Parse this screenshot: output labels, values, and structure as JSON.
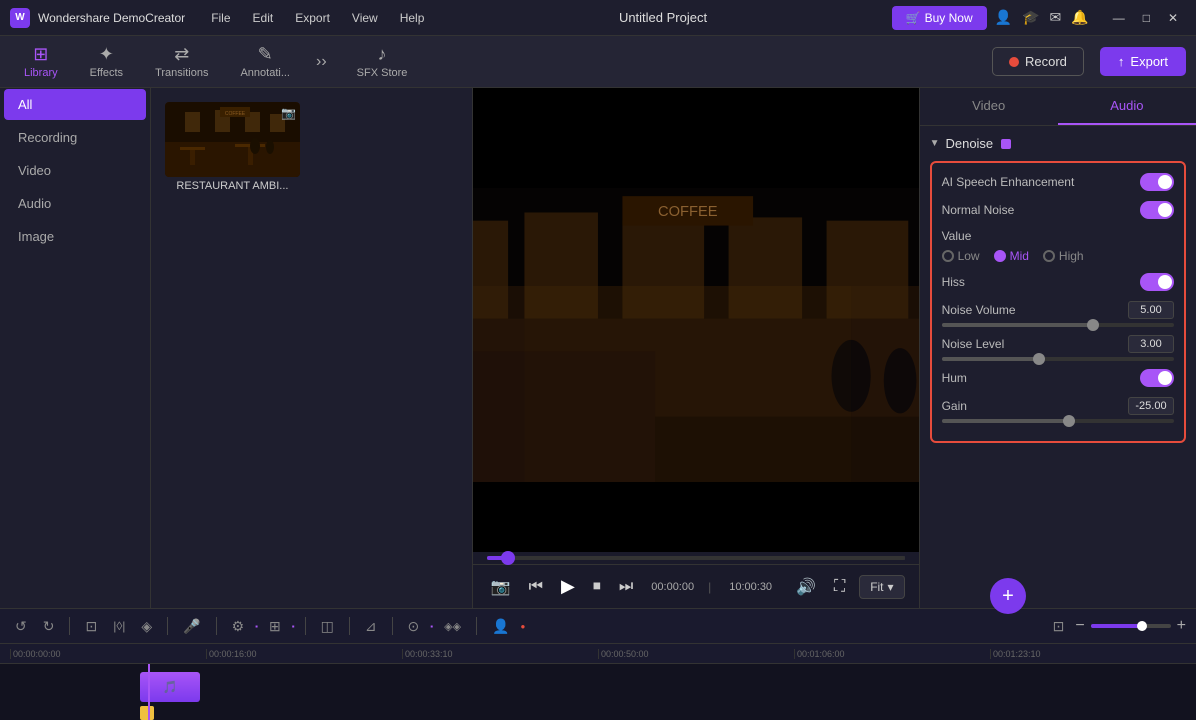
{
  "app": {
    "name": "Wondershare DemoCreator",
    "project_title": "Untitled Project"
  },
  "titlebar": {
    "menu_items": [
      "File",
      "Edit",
      "Export",
      "View",
      "Help"
    ],
    "buy_now": "Buy Now",
    "win_controls": [
      "—",
      "□",
      "✕"
    ]
  },
  "toolbar": {
    "tabs": [
      {
        "id": "library",
        "label": "Library",
        "icon": "⊞",
        "active": true
      },
      {
        "id": "effects",
        "label": "Effects",
        "icon": "✦"
      },
      {
        "id": "transitions",
        "label": "Transitions",
        "icon": "⇄"
      },
      {
        "id": "annotations",
        "label": "Annotati...",
        "icon": "✎"
      },
      {
        "id": "sfxstore",
        "label": "SFX Store",
        "icon": "♪"
      }
    ],
    "record_label": "Record",
    "export_label": "Export"
  },
  "sidebar": {
    "items": [
      {
        "id": "all",
        "label": "All",
        "active": true
      },
      {
        "id": "recording",
        "label": "Recording"
      },
      {
        "id": "video",
        "label": "Video"
      },
      {
        "id": "audio",
        "label": "Audio"
      },
      {
        "id": "image",
        "label": "Image"
      }
    ]
  },
  "media": {
    "items": [
      {
        "label": "RESTAURANT AMBI..."
      }
    ]
  },
  "preview": {
    "time_current": "00:00:00",
    "time_total": "10:00:30",
    "fit_label": "Fit"
  },
  "right_panel": {
    "tabs": [
      {
        "id": "video",
        "label": "Video"
      },
      {
        "id": "audio",
        "label": "Audio",
        "active": true
      }
    ],
    "section": {
      "title": "Denoise",
      "controls": {
        "ai_speech_label": "AI Speech Enhancement",
        "normal_noise_label": "Normal Noise",
        "value_label": "Value",
        "value_options": [
          {
            "id": "low",
            "label": "Low"
          },
          {
            "id": "mid",
            "label": "Mid",
            "active": true
          },
          {
            "id": "high",
            "label": "High"
          }
        ],
        "hiss_label": "Hiss",
        "noise_volume_label": "Noise Volume",
        "noise_volume_value": "5.00",
        "noise_level_label": "Noise Level",
        "noise_level_value": "3.00",
        "hum_label": "Hum",
        "gain_label": "Gain",
        "gain_value": "-25.00"
      }
    }
  },
  "timeline": {
    "marks": [
      "00:00:00:00",
      "00:00:16:00",
      "00:00:33:10",
      "00:00:50:00",
      "00:01:06:00",
      "00:01:23:10"
    ]
  },
  "bottom_toolbar": {
    "icons": [
      "↺",
      "↻",
      "⊡",
      "✂",
      "⊙",
      "🎤",
      "|",
      "⚙",
      "⊞",
      "|",
      "◫",
      "|",
      "⊿",
      "|",
      "⊙",
      "|",
      "👤"
    ]
  }
}
